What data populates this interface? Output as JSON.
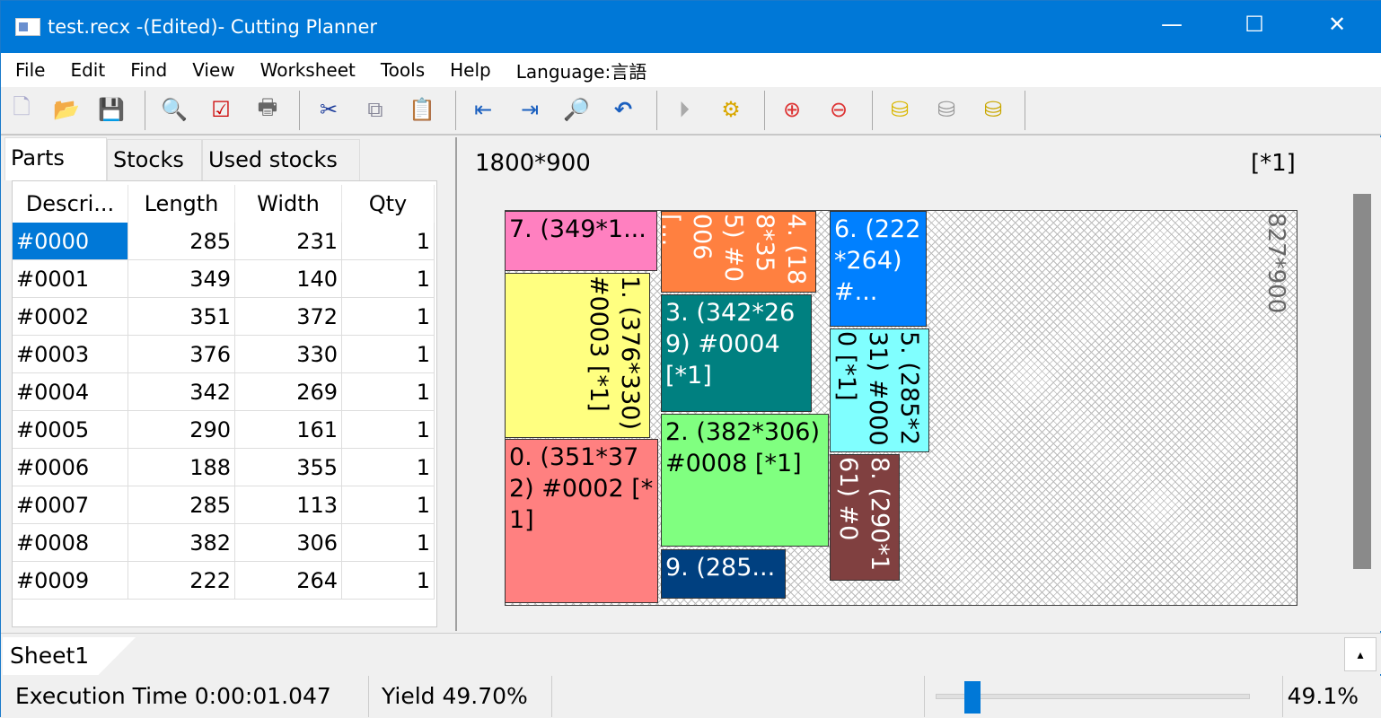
{
  "window": {
    "title": "test.recx -(Edited)- Cutting Planner",
    "minimize": "—",
    "maximize": "☐",
    "close": "✕"
  },
  "menu": [
    "File",
    "Edit",
    "Find",
    "View",
    "Worksheet",
    "Tools",
    "Help",
    "Language:言語"
  ],
  "toolbar": [
    "new-file",
    "open-folder",
    "save",
    "preview",
    "check",
    "print",
    "cut",
    "copy",
    "paste",
    "align-left",
    "align-right",
    "search",
    "undo",
    "run",
    "settings",
    "zoom-in",
    "zoom-out",
    "add-stock",
    "remove-stock",
    "stock-settings"
  ],
  "left": {
    "tabs": [
      "Parts",
      "Stocks",
      "Used stocks"
    ],
    "columns": [
      "Descri...",
      "Length",
      "Width",
      "Qty"
    ],
    "rows": [
      [
        "#0000",
        "285",
        "231",
        "1"
      ],
      [
        "#0001",
        "349",
        "140",
        "1"
      ],
      [
        "#0002",
        "351",
        "372",
        "1"
      ],
      [
        "#0003",
        "376",
        "330",
        "1"
      ],
      [
        "#0004",
        "342",
        "269",
        "1"
      ],
      [
        "#0005",
        "290",
        "161",
        "1"
      ],
      [
        "#0006",
        "188",
        "355",
        "1"
      ],
      [
        "#0007",
        "285",
        "113",
        "1"
      ],
      [
        "#0008",
        "382",
        "306",
        "1"
      ],
      [
        "#0009",
        "222",
        "264",
        "1"
      ]
    ]
  },
  "canvas": {
    "stock_size": "1800*900",
    "count": "[*1]",
    "remainder": "827*900",
    "pieces": {
      "p7": {
        "label": "7. (349*1...",
        "color": "#ff80c0"
      },
      "p1": {
        "label": "1. (376*330) #0003 [*1]",
        "color": "#ffff80"
      },
      "p0": {
        "label": "0. (351*372) #0002 [*1]",
        "color": "#ff8080"
      },
      "p4": {
        "label": "4. (188*355) #0006 [...",
        "color": "#ff8040"
      },
      "p3": {
        "label": "3. (342*269) #0004 [*1]",
        "color": "#008080"
      },
      "p2": {
        "label": "2. (382*306) #0008 [*1]",
        "color": "#80ff80"
      },
      "p9": {
        "label": "9. (285...",
        "color": "#004080"
      },
      "p6": {
        "label": "6. (222*264) #...",
        "color": "#0080ff"
      },
      "p5": {
        "label": "5. (285*231) #0000 [*1]",
        "color": "#80ffff"
      },
      "p8": {
        "label": "8. (290*161) #00...",
        "color": "#804040"
      }
    }
  },
  "sheet": {
    "tab": "Sheet1",
    "scroll_btn": "▴"
  },
  "status": {
    "exec": "Execution Time 0:00:01.047",
    "yield": "Yield 49.70%",
    "zoom": "49.1%",
    "zoom_slider": 0.09
  }
}
